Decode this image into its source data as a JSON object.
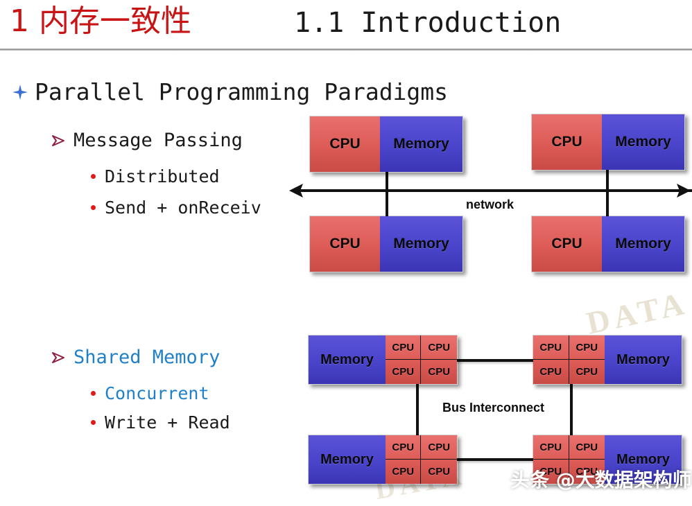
{
  "header": {
    "chapter_title": "1 内存一致性",
    "section_title": "1.1 Introduction"
  },
  "outline": {
    "level1": {
      "bullet_icon": "blue-four-point-star-icon",
      "text": "Parallel Programming Paradigms"
    },
    "topics": [
      {
        "bullet_icon": "dark-red-arrow-icon",
        "text": "Message Passing",
        "color": "#1a1a1a",
        "points": [
          {
            "bullet_icon": "red-dot-icon",
            "text": "Distributed",
            "color": "#1a1a1a"
          },
          {
            "bullet_icon": "red-dot-icon",
            "text": "Send + onReceiv",
            "color": "#1a1a1a"
          }
        ]
      },
      {
        "bullet_icon": "dark-red-arrow-icon",
        "text": "Shared Memory",
        "color": "#2080c8",
        "points": [
          {
            "bullet_icon": "red-dot-icon",
            "text": "Concurrent",
            "color": "#2080c8"
          },
          {
            "bullet_icon": "red-dot-icon",
            "text": "Write + Read",
            "color": "#1a1a1a"
          }
        ]
      }
    ]
  },
  "diagrams": {
    "message_passing": {
      "link_label": "network",
      "nodes": [
        {
          "position": "top-left",
          "cpu": "CPU",
          "memory": "Memory"
        },
        {
          "position": "top-right",
          "cpu": "CPU",
          "memory": "Memory"
        },
        {
          "position": "bottom-left",
          "cpu": "CPU",
          "memory": "Memory"
        },
        {
          "position": "bottom-right",
          "cpu": "CPU",
          "memory": "Memory"
        }
      ]
    },
    "shared_memory": {
      "link_label": "Bus Interconnect",
      "nodes": [
        {
          "position": "top-left",
          "memory": "Memory",
          "cpus": [
            "CPU",
            "CPU",
            "CPU",
            "CPU"
          ]
        },
        {
          "position": "top-right",
          "memory": "Memory",
          "cpus": [
            "CPU",
            "CPU",
            "CPU",
            "CPU"
          ]
        },
        {
          "position": "bottom-left",
          "memory": "Memory",
          "cpus": [
            "CPU",
            "CPU",
            "CPU",
            "CPU"
          ]
        },
        {
          "position": "bottom-right",
          "memory": "Memory",
          "cpus": [
            "CPU",
            "CPU",
            "CPU",
            "CPU"
          ]
        }
      ]
    }
  },
  "watermarks": {
    "corner": "头条 @大数据架构师",
    "background_1": "DATA",
    "background_2": "DATA"
  },
  "colors": {
    "title_red": "#c81414",
    "accent_blue": "#2080c8",
    "cpu_red": "#dd5b57",
    "memory_blue": "#4a44cb",
    "bullet_red": "#e01b1b",
    "star_blue": "#3a6fd8"
  }
}
